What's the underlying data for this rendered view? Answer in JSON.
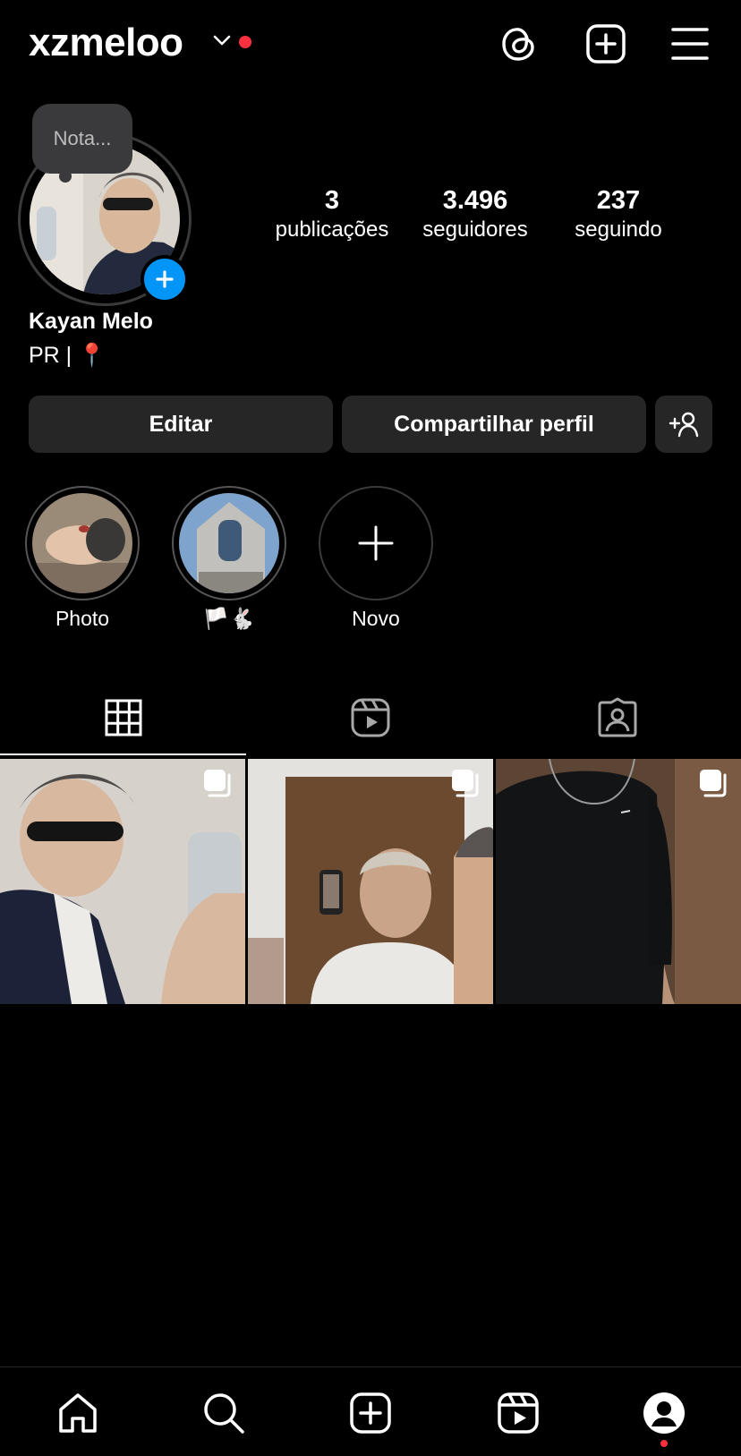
{
  "header": {
    "username": "xzmeloo",
    "has_notification": true
  },
  "profile": {
    "note_placeholder": "Nota...",
    "stats": [
      {
        "value": "3",
        "label": "publicações"
      },
      {
        "value": "3.496",
        "label": "seguidores"
      },
      {
        "value": "237",
        "label": "seguindo"
      }
    ],
    "full_name": "Kayan Melo",
    "bio": "PR | 📍"
  },
  "actions": {
    "edit_label": "Editar",
    "share_label": "Compartilhar perfil"
  },
  "highlights": [
    {
      "label": "Photo"
    },
    {
      "label": "🏳️🐇"
    },
    {
      "label": "Novo"
    }
  ],
  "tabs": [
    {
      "icon": "grid-icon",
      "active": true
    },
    {
      "icon": "reels-icon",
      "active": false
    },
    {
      "icon": "tagged-icon",
      "active": false
    }
  ],
  "colors": {
    "accent": "#0095f6",
    "notification": "#ff3040",
    "button_bg": "#262626"
  }
}
